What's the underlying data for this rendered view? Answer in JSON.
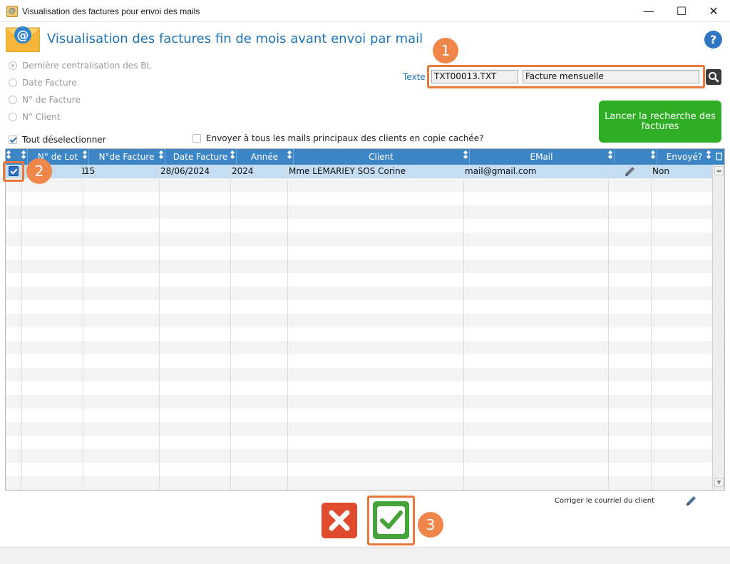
{
  "window": {
    "title": "Visualisation des factures pour envoi des mails",
    "minimize": "—",
    "maximize": "☐",
    "close": "✕",
    "app_icon": "@"
  },
  "header": {
    "title": "Visualisation des factures fin de mois avant envoi par mail",
    "help": "?"
  },
  "filters": {
    "radios": [
      {
        "label": "Dernière centralisation des BL",
        "checked": true
      },
      {
        "label": "Date Facture",
        "checked": false
      },
      {
        "label": "N° de Facture",
        "checked": false
      },
      {
        "label": "N° Client",
        "checked": false
      }
    ],
    "texte_label": "Texte",
    "field1": "TXT00013.TXT",
    "field2": "Facture mensuelle"
  },
  "launch_button": "Lancer la recherche des factures",
  "deselect_all": {
    "label": "Tout déselectionner",
    "checked": true
  },
  "send_all": {
    "label": "Envoyer à tous les mails principaux des clients en copie cachée?",
    "checked": false
  },
  "table": {
    "columns": [
      "N° de Lot",
      "N°de Facture",
      "Date Facture",
      "Année",
      "Client",
      "EMail",
      "",
      "Envoyé?"
    ],
    "rows": [
      {
        "selected": true,
        "lot": "1",
        "facture": "15",
        "date": "28/06/2024",
        "annee": "2024",
        "client": "Mme LEMARIEY SOS Corine",
        "email": "mail@gmail.com",
        "envoye": "Non"
      }
    ]
  },
  "steps": [
    "1",
    "2",
    "3"
  ],
  "footer": {
    "correct_label": "Corriger le courriel du client"
  },
  "colors": {
    "accent": "#1f74b8",
    "header_bg": "#3d86c6",
    "launch_green": "#2fad24",
    "highlight_orange": "#e8783c",
    "cancel_red": "#e04b2d",
    "validate_green": "#46a33a"
  }
}
